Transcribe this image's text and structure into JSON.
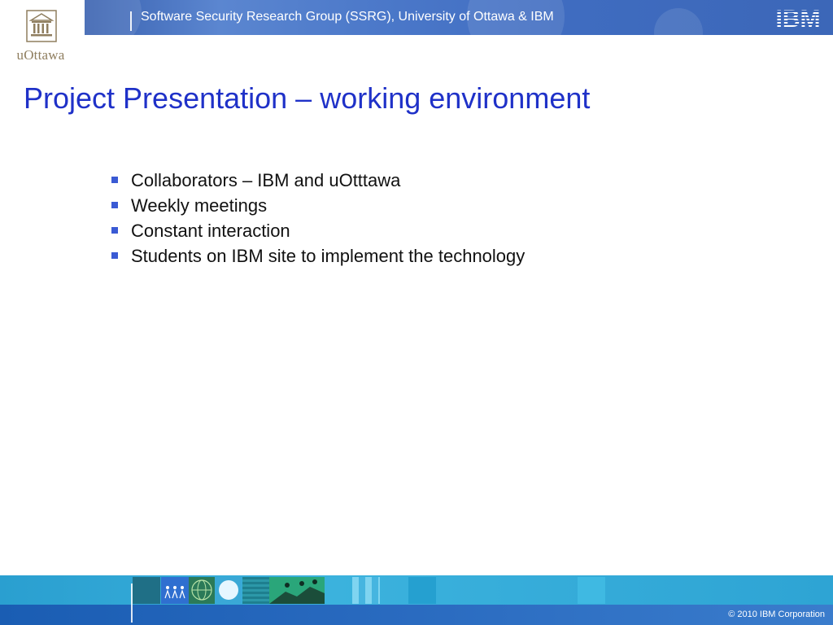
{
  "header": {
    "university_logo_text": "uOttawa",
    "title": "Software Security Research Group (SSRG), University of Ottawa & IBM",
    "ibm_logo_text": "IBM"
  },
  "slide": {
    "title": "Project Presentation – working environment",
    "bullets": [
      "Collaborators – IBM and uOtttawa",
      "Weekly meetings",
      "Constant interaction",
      "Students on IBM site to implement the technology"
    ]
  },
  "footer": {
    "copyright": "© 2010 IBM Corporation"
  },
  "colors": {
    "title_blue": "#1f31c8",
    "bullet_marker": "#3a5ad4",
    "header_band": "#4b78c9",
    "footer_light": "#2ea4d4",
    "footer_dark": "#1a5db3",
    "uottawa_logo": "#8f7e5f"
  },
  "icons": {
    "university_logo": "building-columns-icon",
    "ibm_logo": "ibm-striped-logo",
    "bullet": "square-bullet-icon"
  }
}
